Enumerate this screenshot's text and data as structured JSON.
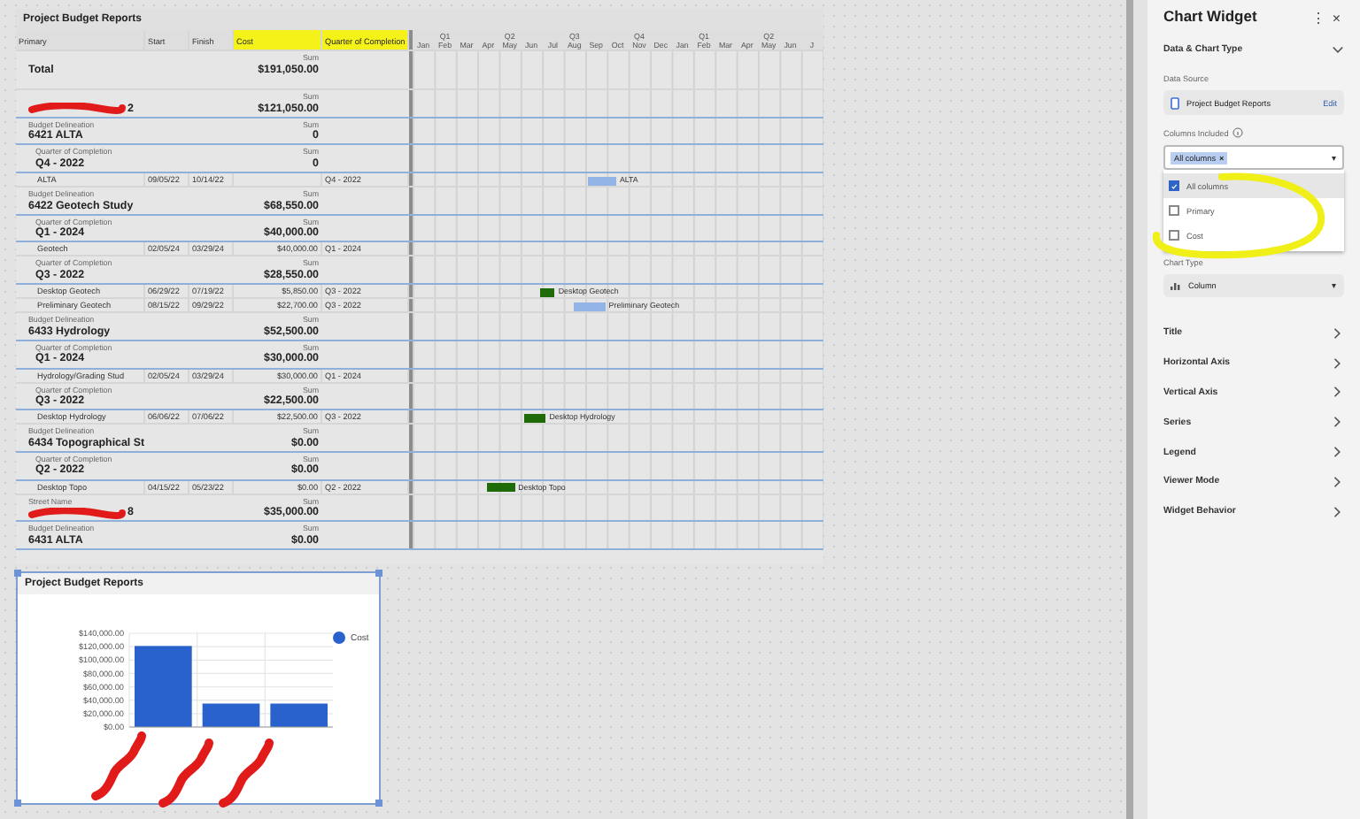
{
  "report": {
    "title": "Project Budget Reports",
    "columns": [
      {
        "label": "Primary",
        "highlighted": false
      },
      {
        "label": "Start",
        "highlighted": false
      },
      {
        "label": "Finish",
        "highlighted": false
      },
      {
        "label": "Cost",
        "highlighted": true
      },
      {
        "label": "Quarter of Completion",
        "highlighted": true
      }
    ],
    "months": [
      {
        "label": "Jan"
      },
      {
        "label": "Feb",
        "quarter": "Q1"
      },
      {
        "label": "Mar"
      },
      {
        "label": "Apr"
      },
      {
        "label": "May",
        "quarter": "Q2"
      },
      {
        "label": "Jun"
      },
      {
        "label": "Jul"
      },
      {
        "label": "Aug",
        "quarter": "Q3"
      },
      {
        "label": "Sep"
      },
      {
        "label": "Oct"
      },
      {
        "label": "Nov",
        "quarter": "Q4"
      },
      {
        "label": "Dec"
      },
      {
        "label": "Jan"
      },
      {
        "label": "Feb",
        "quarter": "Q1"
      },
      {
        "label": "Mar"
      },
      {
        "label": "Apr"
      },
      {
        "label": "May",
        "quarter": "Q2"
      },
      {
        "label": "Jun"
      },
      {
        "label": "J"
      }
    ],
    "rows": [
      {
        "kind": "total",
        "name": "Total",
        "sum_label": "Sum",
        "sum": "$191,050.00"
      },
      {
        "kind": "group",
        "redacted": true,
        "name": "2",
        "sum_label": "Sum",
        "sum": "$121,050.00"
      },
      {
        "kind": "group",
        "caption": "Budget Delineation",
        "name": "6421 ALTA",
        "sum_label": "Sum",
        "sum": "0"
      },
      {
        "kind": "group",
        "caption": "Quarter of Completion",
        "name": "Q4 - 2022",
        "sum_label": "Sum",
        "sum": "0",
        "indent": true
      },
      {
        "kind": "task",
        "name": "ALTA",
        "start": "09/05/22",
        "finish": "10/14/22",
        "quarter": "Q4 - 2022",
        "bar_label": "ALTA",
        "color": "#92b4e6"
      },
      {
        "kind": "group",
        "caption": "Budget Delineation",
        "name": "6422 Geotech Study",
        "sum_label": "Sum",
        "sum": "$68,550.00"
      },
      {
        "kind": "group",
        "caption": "Quarter of Completion",
        "name": "Q1 - 2024",
        "sum_label": "Sum",
        "sum": "$40,000.00",
        "indent": true
      },
      {
        "kind": "task",
        "name": "Geotech",
        "start": "02/05/24",
        "finish": "03/29/24",
        "cost": "$40,000.00",
        "quarter": "Q1 - 2024"
      },
      {
        "kind": "group",
        "caption": "Quarter of Completion",
        "name": "Q3 - 2022",
        "sum_label": "Sum",
        "sum": "$28,550.00",
        "indent": true
      },
      {
        "kind": "task",
        "name": "Desktop Geotech",
        "start": "06/29/22",
        "finish": "07/19/22",
        "cost": "$5,850.00",
        "quarter": "Q3 - 2022",
        "bar_label": "Desktop Geotech",
        "color": "#1f6b0a"
      },
      {
        "kind": "task",
        "name": "Preliminary Geotech",
        "start": "08/15/22",
        "finish": "09/29/22",
        "cost": "$22,700.00",
        "quarter": "Q3 - 2022",
        "bar_label": "Preliminary Geotech",
        "color": "#92b4e6"
      },
      {
        "kind": "group",
        "caption": "Budget Delineation",
        "name": "6433 Hydrology",
        "sum_label": "Sum",
        "sum": "$52,500.00"
      },
      {
        "kind": "group",
        "caption": "Quarter of Completion",
        "name": "Q1 - 2024",
        "sum_label": "Sum",
        "sum": "$30,000.00",
        "indent": true
      },
      {
        "kind": "task",
        "name": "Hydrology/Grading Stud",
        "start": "02/05/24",
        "finish": "03/29/24",
        "cost": "$30,000.00",
        "quarter": "Q1 - 2024"
      },
      {
        "kind": "group",
        "caption": "Quarter of Completion",
        "name": "Q3 - 2022",
        "sum_label": "Sum",
        "sum": "$22,500.00",
        "indent": true
      },
      {
        "kind": "task",
        "name": "Desktop Hydrology",
        "start": "06/06/22",
        "finish": "07/06/22",
        "cost": "$22,500.00",
        "quarter": "Q3 - 2022",
        "bar_label": "Desktop Hydrology",
        "color": "#1f6b0a"
      },
      {
        "kind": "group",
        "caption": "Budget Delineation",
        "name": "6434 Topographical St",
        "sum_label": "Sum",
        "sum": "$0.00"
      },
      {
        "kind": "group",
        "caption": "Quarter of Completion",
        "name": "Q2 - 2022",
        "sum_label": "Sum",
        "sum": "$0.00",
        "indent": true
      },
      {
        "kind": "task",
        "name": "Desktop Topo",
        "start": "04/15/22",
        "finish": "05/23/22",
        "cost": "$0.00",
        "quarter": "Q2 - 2022",
        "bar_label": "Desktop Topo",
        "color": "#1f6b0a"
      },
      {
        "kind": "group",
        "redacted": true,
        "caption": "Street Name",
        "name": "8",
        "sum_label": "Sum",
        "sum": "$35,000.00"
      },
      {
        "kind": "group",
        "caption": "Budget Delineation",
        "name": "6431 ALTA",
        "sum_label": "Sum",
        "sum": "$0.00"
      }
    ]
  },
  "chart_widget": {
    "title": "Project Budget Reports",
    "chart_data": {
      "type": "bar",
      "grid": true,
      "ylim": [
        0,
        140000
      ],
      "yticks": [
        {
          "value": 0,
          "label": "$0.00"
        },
        {
          "value": 20000,
          "label": "$20,000.00"
        },
        {
          "value": 40000,
          "label": "$40,000.00"
        },
        {
          "value": 60000,
          "label": "$60,000.00"
        },
        {
          "value": 80000,
          "label": "$80,000.00"
        },
        {
          "value": 100000,
          "label": "$100,000.00"
        },
        {
          "value": 120000,
          "label": "$120,000.00"
        },
        {
          "value": 140000,
          "label": "$140,000.00"
        }
      ],
      "series": [
        {
          "name": "Cost",
          "color": "#2962cc",
          "values": [
            121000,
            35000,
            35000
          ]
        }
      ]
    }
  },
  "panel": {
    "title": "Chart Widget",
    "menu": "⋮",
    "close": "×",
    "section": "Data & Chart Type",
    "data_source_label": "Data Source",
    "data_source": "Project Budget Reports",
    "edit": "Edit",
    "columns_label": "Columns Included",
    "chip": "All columns",
    "chip_remove": "×",
    "caret": "▾",
    "options": [
      {
        "label": "All columns",
        "checked": true,
        "selected": true
      },
      {
        "label": "Primary",
        "checked": false,
        "selected": false
      },
      {
        "label": "Cost",
        "checked": false,
        "selected": false
      }
    ],
    "chart_type_label": "Chart Type",
    "chart_type": "Column",
    "chart_type_caret": "▾",
    "items": [
      "Title",
      "Horizontal Axis",
      "Vertical Axis",
      "Series",
      "Legend",
      "Viewer Mode",
      "Widget Behavior"
    ]
  }
}
